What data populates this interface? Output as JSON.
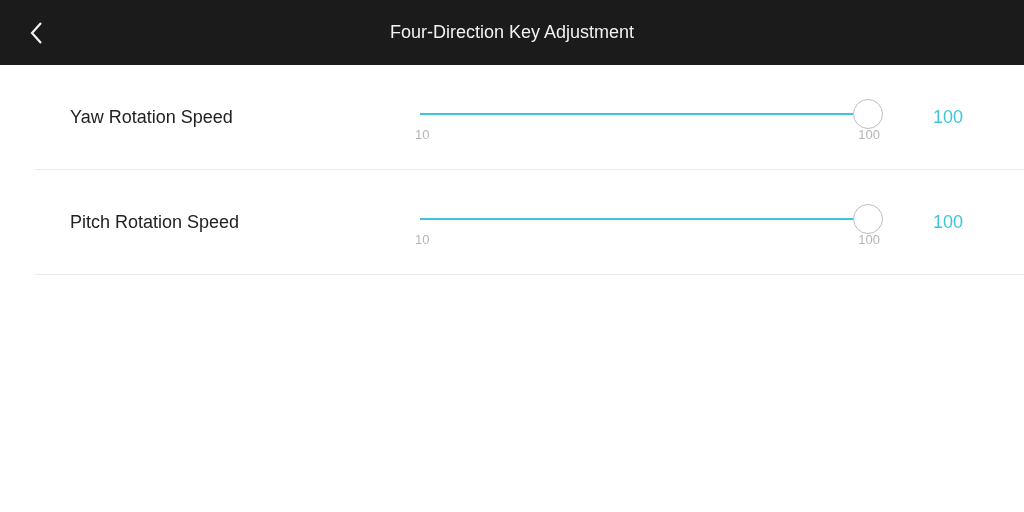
{
  "header": {
    "title": "Four-Direction Key Adjustment"
  },
  "settings": [
    {
      "label": "Yaw Rotation Speed",
      "min": "10",
      "max": "100",
      "level": 1,
      "value": "100"
    },
    {
      "label": "Pitch Rotation Speed",
      "min": "10",
      "max": "100",
      "level": 1,
      "value": "100"
    }
  ]
}
